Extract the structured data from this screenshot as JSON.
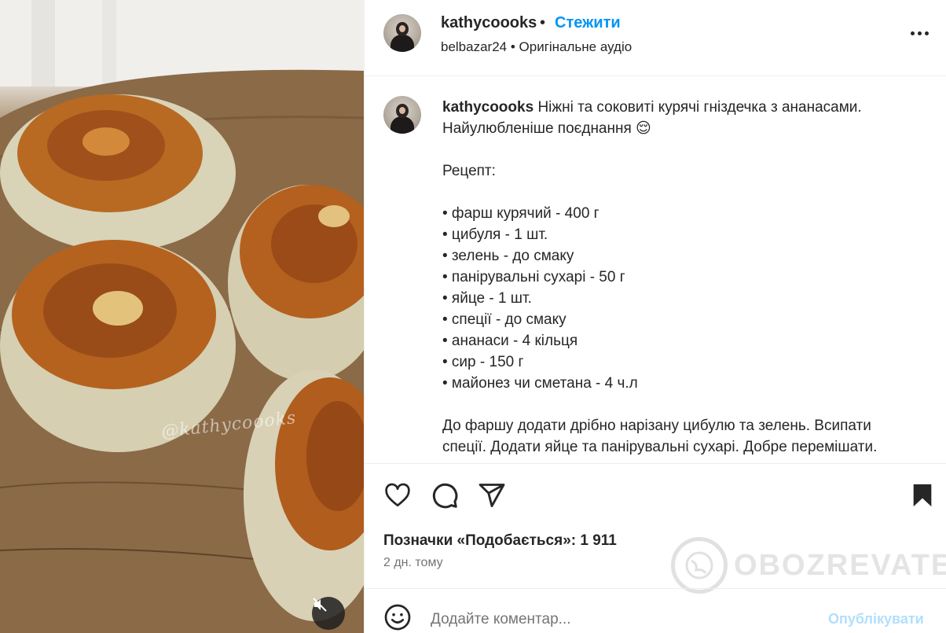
{
  "post": {
    "username": "kathycoooks",
    "follow_label": "Стежити",
    "audio_line": "belbazar24 • Оригінальне аудіо",
    "watermark_text": "@kathycoooks",
    "caption_username": "kathycoooks",
    "caption_lines": [
      "Ніжні та соковиті курячі гніздечка з ананасами.",
      "Найулюбленіше поєднання 😌",
      "",
      "Рецепт:",
      "",
      "• фарш курячий - 400 г",
      "• цибуля - 1 шт.",
      "• зелень - до смаку",
      "• панірувальні сухарі - 50 г",
      "• яйце - 1 шт.",
      "• спеції - до смаку",
      "• ананаси - 4 кільця",
      "• сир - 150 г",
      "• майонез чи сметана - 4 ч.л",
      "",
      "До фаршу додати дрібно нарізану цибулю та зелень. Всипати",
      "спеції. Додати яйце та панірувальні сухарі. Добре перемішати."
    ],
    "likes_label": "Позначки «Подобається»: 1 911",
    "time_label": "2 дн. тому",
    "comment_placeholder": "Додайте коментар...",
    "publish_label": "Опублікувати",
    "site_watermark": "OBOZREVATEL"
  },
  "icons": {
    "more": "more-options-icon",
    "like": "heart-icon",
    "comment": "comment-icon",
    "share": "send-icon",
    "save": "bookmark-icon",
    "emoji": "emoji-icon",
    "mute": "muted-speaker-icon"
  },
  "colors": {
    "link": "#0095f6",
    "publish_disabled": "#b2dffc",
    "text": "#262626",
    "muted": "#737373"
  }
}
